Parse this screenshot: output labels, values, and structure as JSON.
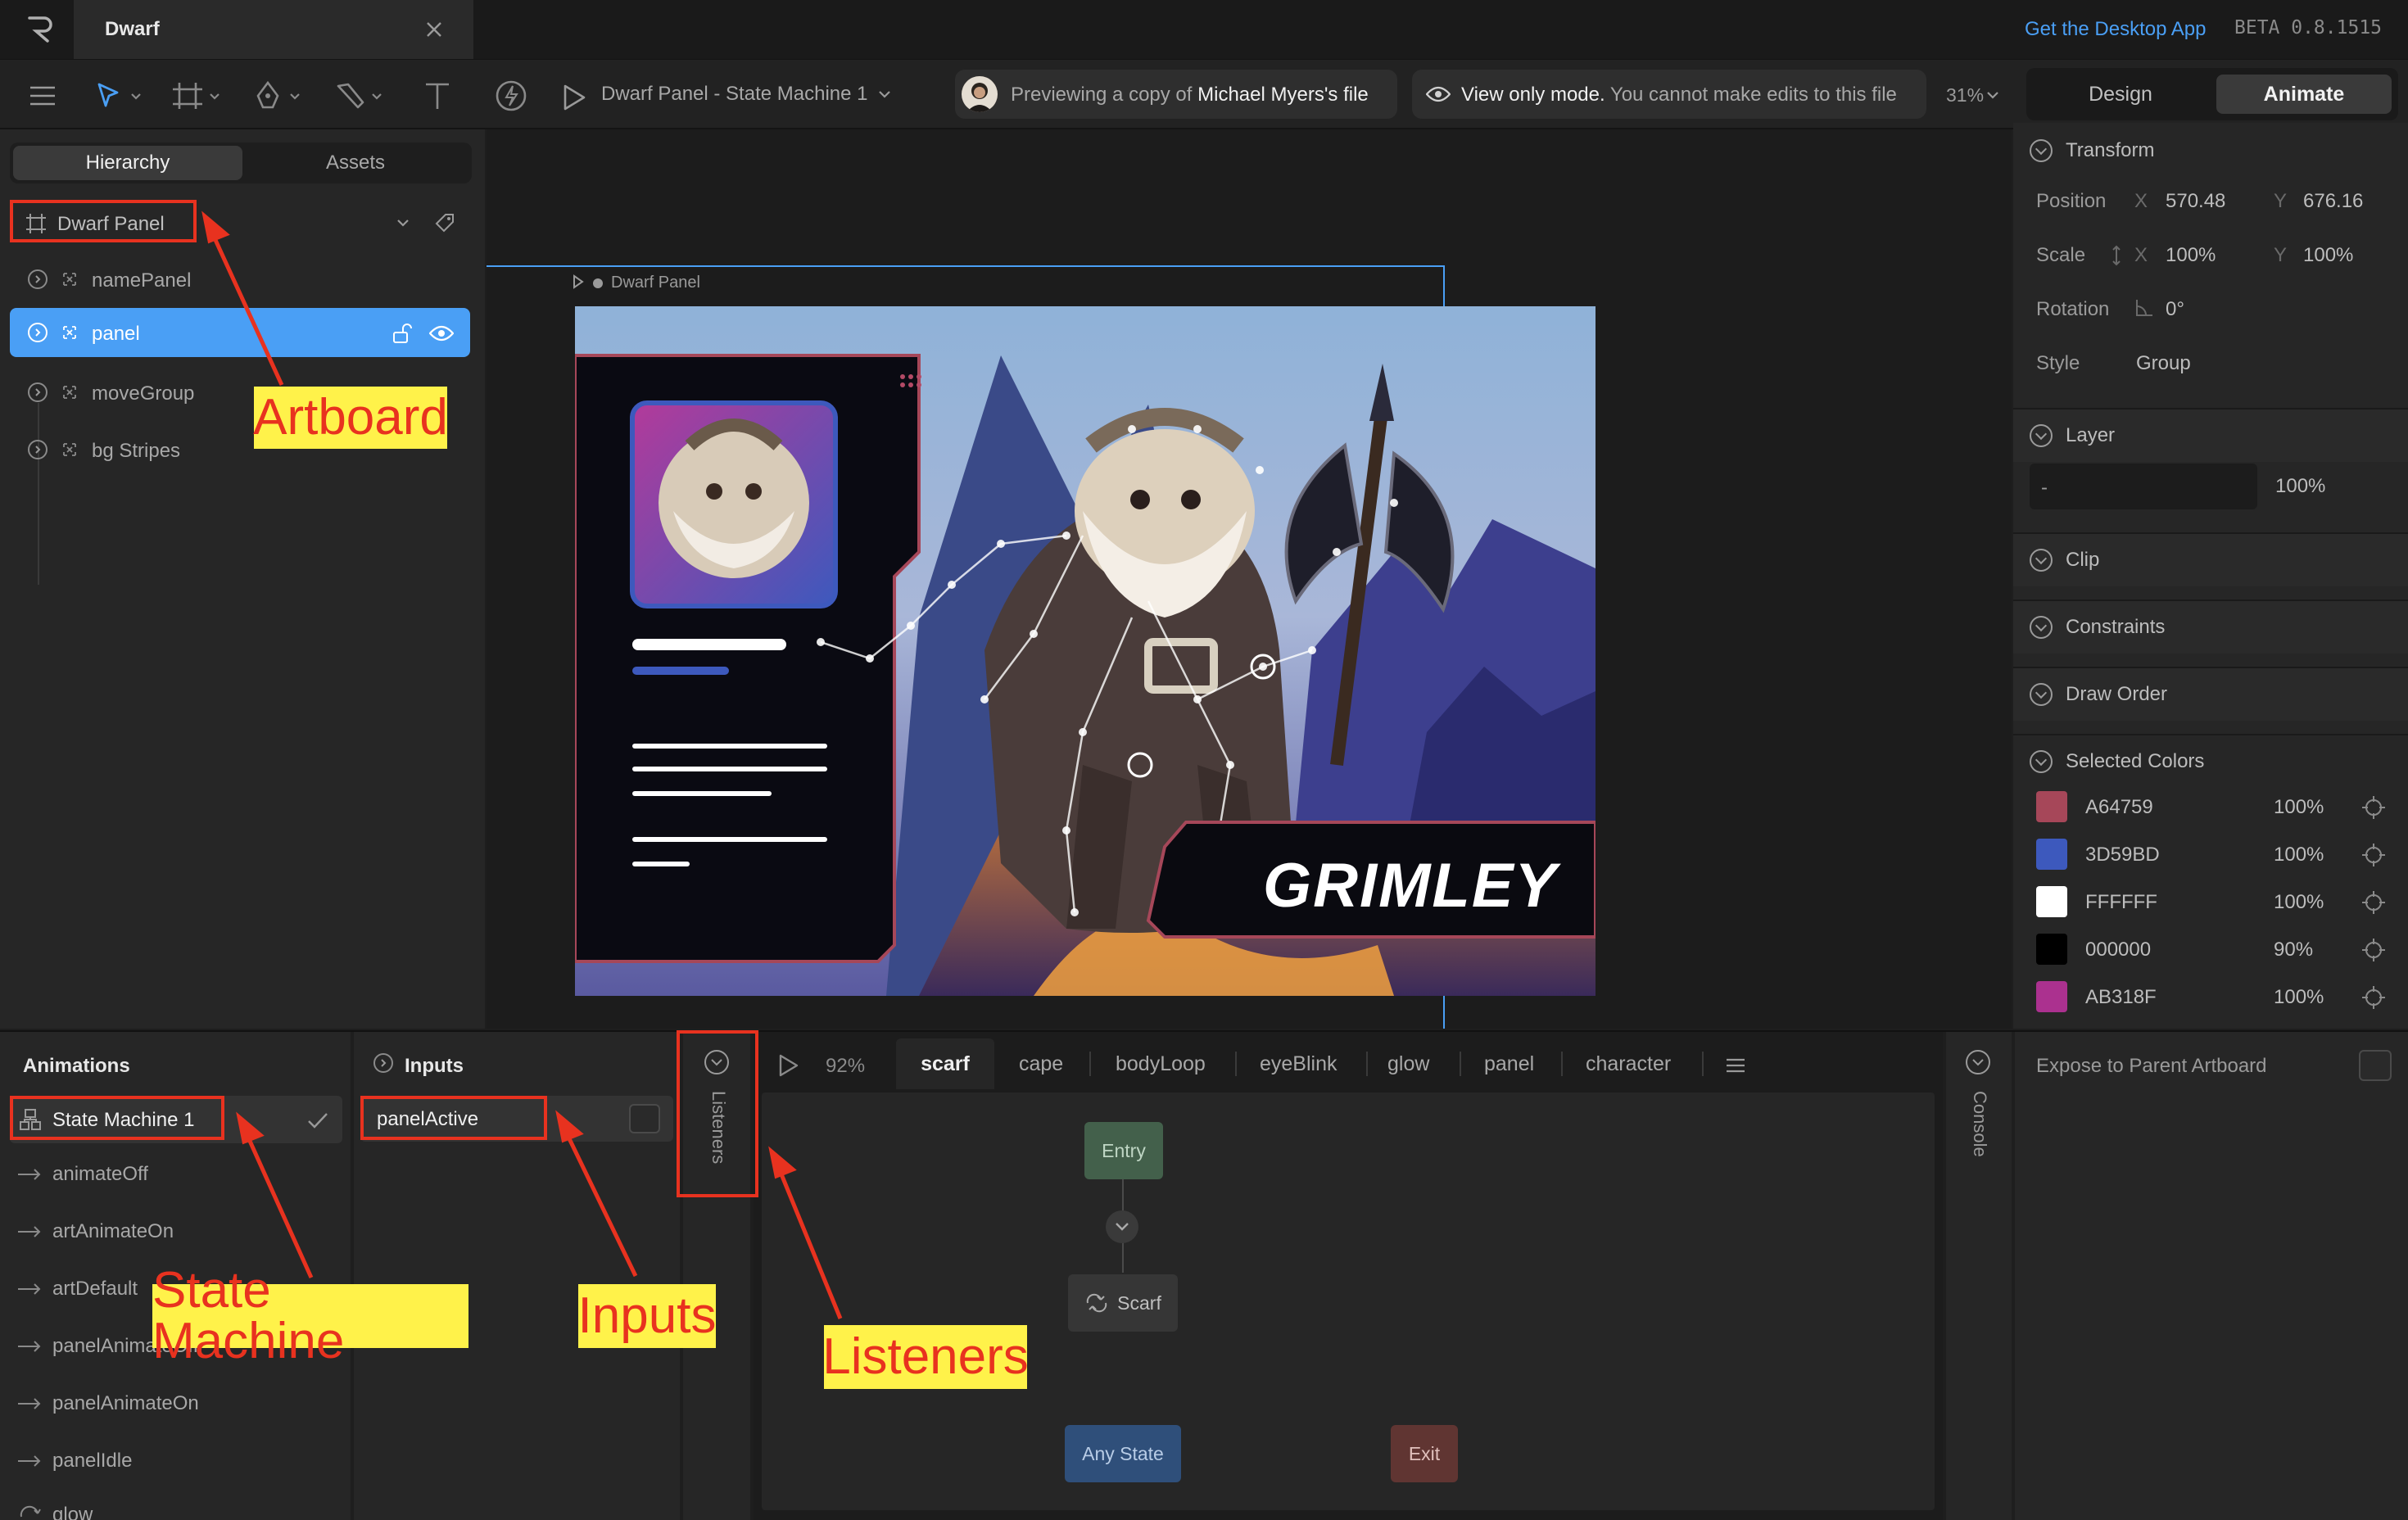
{
  "titlebar": {
    "doc_tab_title": "Dwarf",
    "desktop_app_link": "Get the Desktop App",
    "version": "BETA 0.8.1515"
  },
  "toolbar": {
    "breadcrumb": "Dwarf Panel - State Machine 1",
    "preview_text_prefix": "Previewing a copy of ",
    "preview_owner": "Michael Myers's file",
    "view_only_bold": "View only mode.",
    "view_only_rest": " You cannot make edits to this file",
    "zoom": "31%",
    "mode_design": "Design",
    "mode_animate": "Animate"
  },
  "left_panel": {
    "tab_hierarchy": "Hierarchy",
    "tab_assets": "Assets",
    "artboard_name": "Dwarf Panel",
    "items": [
      {
        "label": "namePanel"
      },
      {
        "label": "panel"
      },
      {
        "label": "moveGroup"
      },
      {
        "label": "bg Stripes"
      }
    ]
  },
  "canvas": {
    "artboard_label": "Dwarf Panel",
    "character_name": "GRIMLEY"
  },
  "right_panel": {
    "transform": {
      "title": "Transform",
      "position_label": "Position",
      "x_axis": "X",
      "y_axis": "Y",
      "position_x": "570.48",
      "position_y": "676.16",
      "scale_label": "Scale",
      "scale_x": "100%",
      "scale_y": "100%",
      "rotation_label": "Rotation",
      "rotation": "0°",
      "style_label": "Style",
      "style": "Group"
    },
    "layer": {
      "title": "Layer",
      "blend": "-",
      "opacity": "100%"
    },
    "clip_title": "Clip",
    "constraints_title": "Constraints",
    "draw_order_title": "Draw Order",
    "selected_colors": {
      "title": "Selected Colors",
      "colors": [
        {
          "hex": "A64759",
          "opacity": "100%",
          "color": "#A64759"
        },
        {
          "hex": "3D59BD",
          "opacity": "100%",
          "color": "#3D59BD"
        },
        {
          "hex": "FFFFFF",
          "opacity": "100%",
          "color": "#FFFFFF"
        },
        {
          "hex": "000000",
          "opacity": "90%",
          "color": "#000000"
        },
        {
          "hex": "AB318F",
          "opacity": "100%",
          "color": "#AB318F"
        }
      ]
    },
    "expose_to_parent": "Expose to Parent Artboard"
  },
  "animations": {
    "title": "Animations",
    "state_machine": "State Machine 1",
    "items": [
      {
        "label": "animateOff"
      },
      {
        "label": "artAnimateOn"
      },
      {
        "label": "artDefault"
      },
      {
        "label": "panelAnimateOff"
      },
      {
        "label": "panelAnimateOn"
      },
      {
        "label": "panelIdle"
      },
      {
        "label": "glow"
      }
    ]
  },
  "inputs": {
    "title": "Inputs",
    "items": [
      {
        "label": "panelActive"
      }
    ]
  },
  "listeners_label": "Listeners",
  "console_label": "Console",
  "graph": {
    "speed": "92%",
    "tabs": [
      "scarf",
      "cape",
      "bodyLoop",
      "eyeBlink",
      "glow",
      "panel",
      "character"
    ],
    "nodes": {
      "entry": "Entry",
      "scarf": "Scarf",
      "any_state": "Any State",
      "exit": "Exit"
    }
  },
  "annotations": {
    "artboard": "Artboard",
    "state_machine": "State Machine",
    "inputs": "Inputs",
    "listeners": "Listeners"
  },
  "theme": {
    "accent_blue": "#4a9ff5",
    "callout_red": "#e8321f",
    "label_yellow": "#fff24a"
  }
}
